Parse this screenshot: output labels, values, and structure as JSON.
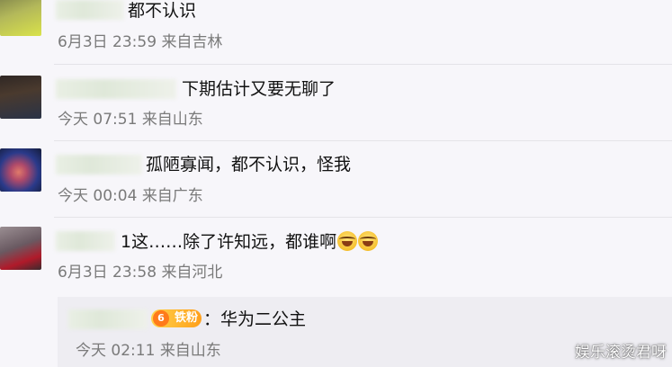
{
  "comments": [
    {
      "text": "都不认识",
      "time": "6月3日 23:59",
      "location": "来自吉林"
    },
    {
      "text": "下期估计又要无聊了",
      "time": "今天 07:51",
      "location": "来自山东"
    },
    {
      "text": "孤陋寡闻，都不认识，怪我",
      "time": "今天 00:04",
      "location": "来自广东"
    },
    {
      "text": "1这……除了许知远，都谁啊",
      "emoji": "laugh-cry-icon",
      "time": "6月3日 23:58",
      "location": "来自河北"
    }
  ],
  "reply": {
    "badge_level": "6",
    "badge_label": "铁粉",
    "text": "：华为二公主",
    "time": "今天 02:11",
    "location": "来自山东"
  },
  "watermark": "娱乐滚烫君呀",
  "colors": {
    "background": "#f7f6fa",
    "meta_text": "#7a7a7a",
    "badge": "#ff9f1a"
  }
}
